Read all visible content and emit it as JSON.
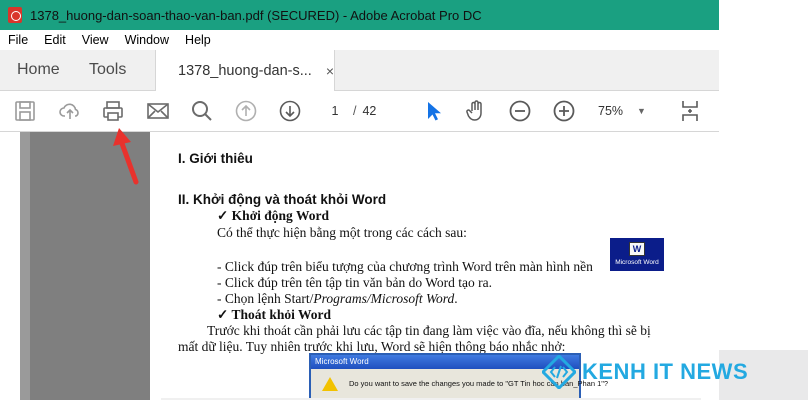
{
  "window": {
    "title": "1378_huong-dan-soan-thao-van-ban.pdf (SECURED) - Adobe Acrobat Pro DC",
    "menus": [
      "File",
      "Edit",
      "View",
      "Window",
      "Help"
    ]
  },
  "tabs": {
    "home": "Home",
    "tools": "Tools",
    "doc": "1378_huong-dan-s...",
    "close": "×"
  },
  "toolbar": {
    "icons": [
      "save-icon",
      "cloud-upload-icon",
      "print-icon",
      "email-icon",
      "search-icon",
      "page-up-icon",
      "page-down-icon",
      "select-cursor-icon",
      "hand-icon",
      "zoom-out-icon",
      "zoom-in-icon",
      "page-layout-icon"
    ],
    "page_current": "1",
    "page_sep": "/",
    "page_total": "42",
    "zoom": "75%"
  },
  "document": {
    "h1": "I. Giới thiêu",
    "h2": "II. Khởi động và thoát khỏi Word",
    "sub1": "✓ Khởi động Word",
    "intro": "Có thể thực hiện bằng một trong các cách sau:",
    "item1": "- Click đúp trên biểu tượng của chương trình Word trên màn hình nền",
    "item2": "- Click đúp trên tên tập tin văn bản do Word tạo ra.",
    "item3_prefix": "- Chọn lệnh Start/",
    "item3_path": "Programs/Microsoft Word",
    "item3_end": ".",
    "sub2": "✓ Thoát khỏi Word",
    "para_line1": "Trước khi thoát cần phải lưu các tập tin đang làm việc vào đĩa, nếu không thì sẽ bị",
    "para_line2": "mất dữ liệu. Tuy nhiên trước khi lưu, Word sẽ hiện thông báo nhắc nhở:",
    "word_icon_label": "Microsoft Word",
    "word_icon_letter": "W",
    "dialog_title": "Microsoft Word",
    "dialog_msg": "Do you want to save the changes you made to \"GT Tin hoc can ban_Phan 1\"?"
  },
  "watermark": {
    "text": "KENH IT NEWS"
  },
  "colors": {
    "titlebar": "#1aa081",
    "watermark": "#23a9e1",
    "annotation_arrow": "#e8322d",
    "select_tool": "#1473e6"
  }
}
